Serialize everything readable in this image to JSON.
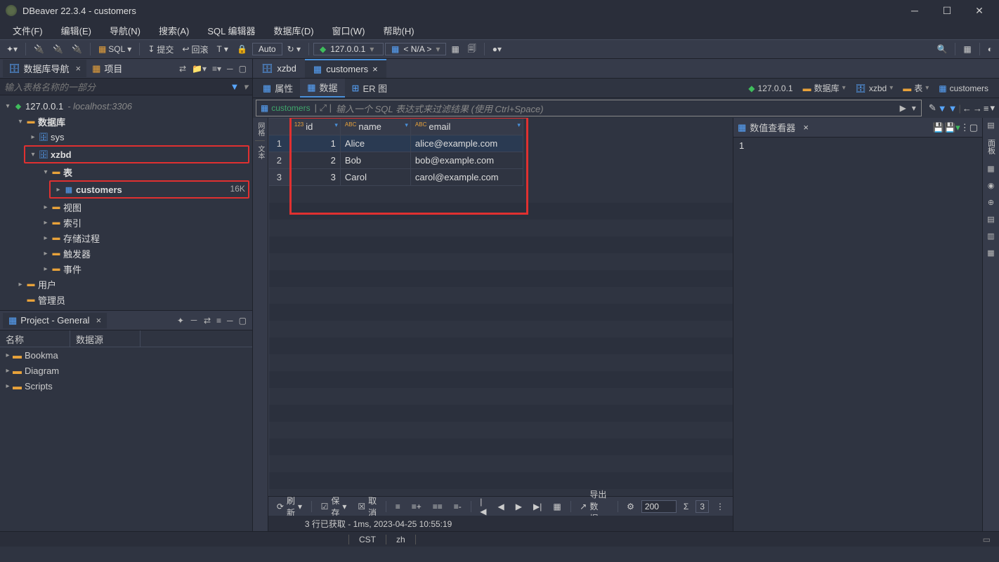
{
  "title": "DBeaver 22.3.4 - customers",
  "menu": [
    "文件(F)",
    "编辑(E)",
    "导航(N)",
    "搜索(A)",
    "SQL 编辑器",
    "数据库(D)",
    "窗口(W)",
    "帮助(H)"
  ],
  "toolbar": {
    "sql": "SQL",
    "commit": "提交",
    "rollback": "回滚",
    "auto": "Auto",
    "conn": "127.0.0.1",
    "schema": "< N/A >"
  },
  "nav": {
    "tab1": "数据库导航",
    "tab2": "项目",
    "filter_ph": "输入表格名称的一部分",
    "tree": {
      "conn": "127.0.0.1",
      "conn_sub": "- localhost:3306",
      "databases": "数据库",
      "sys": "sys",
      "xzbd": "xzbd",
      "tables": "表",
      "customers": "customers",
      "customers_size": "16K",
      "views": "视图",
      "indexes": "索引",
      "procs": "存储过程",
      "triggers": "触发器",
      "events": "事件",
      "users": "用户",
      "admin": "管理员"
    }
  },
  "project": {
    "title": "Project - General",
    "col1": "名称",
    "col2": "数据源",
    "items": [
      "Bookma",
      "Diagram",
      "Scripts"
    ]
  },
  "editor": {
    "tabs": [
      "xzbd",
      "customers"
    ],
    "subtabs": {
      "props": "属性",
      "data": "数据",
      "er": "ER 图"
    },
    "crumb": {
      "conn": "127.0.0.1",
      "db": "数据库",
      "schema": "xzbd",
      "tables": "表",
      "table": "customers"
    },
    "sql_table": "customers",
    "sql_ph": "输入一个 SQL 表达式来过滤结果 (使用 Ctrl+Space)"
  },
  "grid": {
    "cols": [
      "id",
      "name",
      "email"
    ],
    "rows": [
      {
        "n": 1,
        "id": 1,
        "name": "Alice",
        "email": "alice@example.com"
      },
      {
        "n": 2,
        "id": 2,
        "name": "Bob",
        "email": "bob@example.com"
      },
      {
        "n": 3,
        "id": 3,
        "name": "Carol",
        "email": "carol@example.com"
      }
    ]
  },
  "valueviewer": {
    "title": "数值查看器",
    "value": "1"
  },
  "bottom": {
    "refresh": "刷新",
    "save": "保存",
    "cancel": "取消",
    "export": "导出数据…",
    "pagesize": "200",
    "rowcount": "3"
  },
  "status1": "3 行已获取 - 1ms, 2023-04-25 10:55:19",
  "status2": {
    "tz": "CST",
    "lang": "zh"
  }
}
